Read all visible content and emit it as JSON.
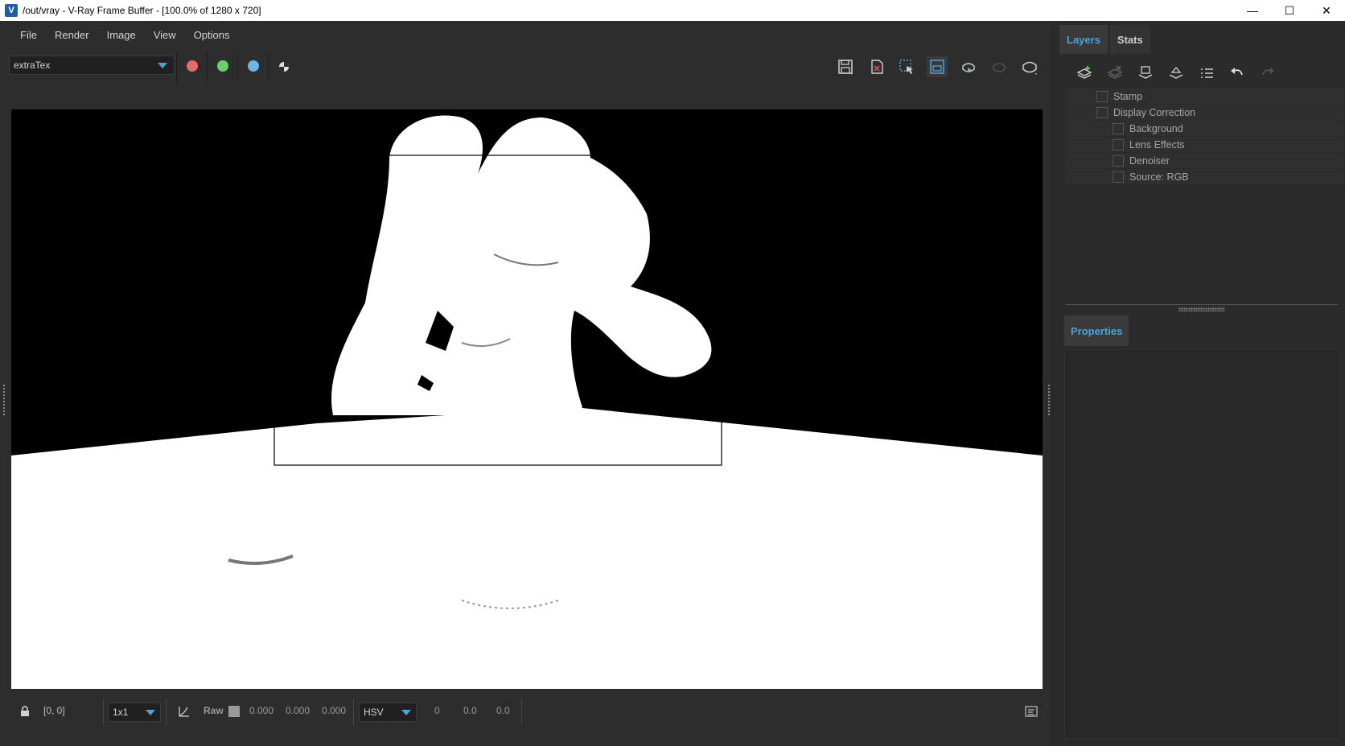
{
  "window": {
    "title": "/out/vray - V-Ray Frame Buffer - [100.0% of 1280 x 720]",
    "icon": "vray-icon",
    "controls": {
      "minimize": "—",
      "maximize": "☐",
      "close": "✕"
    }
  },
  "menu": {
    "items": [
      "File",
      "Render",
      "Image",
      "View",
      "Options"
    ]
  },
  "toolbar": {
    "channel": "extraTex",
    "channel_buttons": [
      {
        "name": "red-channel",
        "color": "#e86a6a"
      },
      {
        "name": "green-channel",
        "color": "#6ad06a"
      },
      {
        "name": "blue-channel",
        "color": "#6ab8ea"
      },
      {
        "name": "alpha-channel",
        "color": "#e0e0e0"
      }
    ],
    "actions": [
      "save-image",
      "clear-image",
      "region-select",
      "track-mouse",
      "render-interactive",
      "stop-render",
      "render"
    ]
  },
  "viewport": {
    "background": "#000000",
    "region_rect": "render-region"
  },
  "statusbar": {
    "coords": "[0, 0]",
    "sample_size": "1x1",
    "raw_label": "Raw",
    "rgb": [
      "0.000",
      "0.000",
      "0.000"
    ],
    "color_mode": "HSV",
    "hsv": [
      "0",
      "0.0",
      "0.0"
    ]
  },
  "right_panel": {
    "tabs": [
      "Layers",
      "Stats"
    ],
    "active_tab": "Layers",
    "layers": [
      {
        "label": "Stamp",
        "indent": 0
      },
      {
        "label": "Display Correction",
        "indent": 0
      },
      {
        "label": "Background",
        "indent": 1
      },
      {
        "label": "Lens Effects",
        "indent": 1
      },
      {
        "label": "Denoiser",
        "indent": 1
      },
      {
        "label": "Source: RGB",
        "indent": 1
      }
    ],
    "properties_tab": "Properties"
  }
}
